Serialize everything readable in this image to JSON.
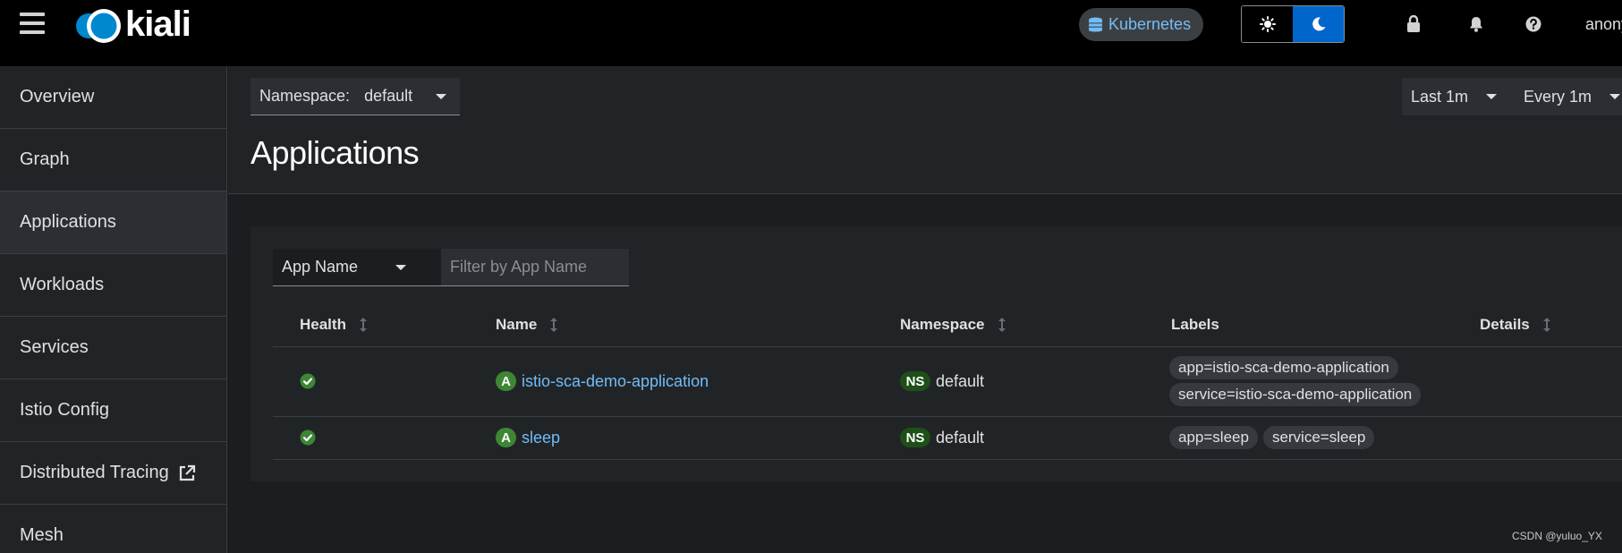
{
  "masthead": {
    "logo_text": "kiali",
    "cluster_label": "Kubernetes",
    "user": "anonymous"
  },
  "sidebar": {
    "items": [
      {
        "label": "Overview"
      },
      {
        "label": "Graph"
      },
      {
        "label": "Applications",
        "active": true
      },
      {
        "label": "Workloads"
      },
      {
        "label": "Services"
      },
      {
        "label": "Istio Config"
      },
      {
        "label": "Distributed Tracing",
        "external": true
      },
      {
        "label": "Mesh"
      }
    ]
  },
  "toolbar": {
    "namespace_label": "Namespace:",
    "namespace_value": "default",
    "duration": "Last 1m",
    "refresh": "Every 1m"
  },
  "page": {
    "title": "Applications"
  },
  "filter": {
    "type": "App Name",
    "placeholder": "Filter by App Name"
  },
  "table": {
    "columns": [
      "Health",
      "Name",
      "Namespace",
      "Labels",
      "Details"
    ],
    "rows": [
      {
        "health": "healthy",
        "app_badge": "A",
        "name": "istio-sca-demo-application",
        "ns_badge": "NS",
        "namespace": "default",
        "labels": [
          "app=istio-sca-demo-application",
          "service=istio-sca-demo-application"
        ]
      },
      {
        "health": "healthy",
        "app_badge": "A",
        "name": "sleep",
        "ns_badge": "NS",
        "namespace": "default",
        "labels": [
          "app=sleep",
          "service=sleep"
        ]
      }
    ]
  },
  "watermark": "CSDN @yuluo_YX",
  "colors": {
    "masthead_bg": "#000000",
    "accent_blue": "#0066cc",
    "link": "#73bcf7",
    "healthy": "#3e8635"
  }
}
